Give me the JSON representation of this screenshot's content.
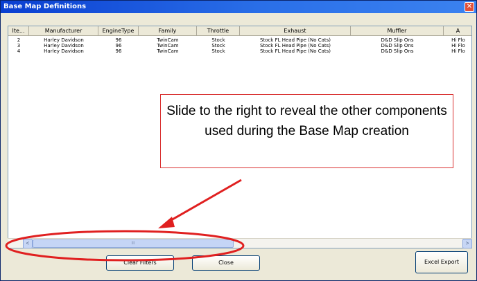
{
  "window": {
    "title": "Base Map Definitions",
    "close_glyph": "✕"
  },
  "grid": {
    "columns": [
      "Ite...",
      "Manufacturer",
      "EngineType",
      "Family",
      "Throttle",
      "Exhaust",
      "Muffler",
      "A"
    ],
    "rows": [
      [
        "2",
        "Harley Davidson",
        "96",
        "TwinCam",
        "Stock",
        "Stock FL Head Pipe (No Cats)",
        "D&D Slip Ons",
        "Hi Flo"
      ],
      [
        "3",
        "Harley Davidson",
        "96",
        "TwinCam",
        "Stock",
        "Stock FL Head Pipe (No Cats)",
        "D&D Slip Ons",
        "Hi Flo"
      ],
      [
        "4",
        "Harley Davidson",
        "96",
        "TwinCam",
        "Stock",
        "Stock FL Head Pipe (No Cats)",
        "D&D Slip Ons",
        "Hi Flo"
      ]
    ]
  },
  "scrollbar": {
    "left_arrow": "<",
    "right_arrow": ">",
    "thumb_grip": "III"
  },
  "buttons": {
    "clear_filters": "Clear Filters",
    "close": "Close",
    "excel_export": "Excel Export"
  },
  "callout": {
    "text": "Slide to the right to reveal the other components used during the Base Map creation"
  },
  "colors": {
    "annotation": "#e02020",
    "titlebar": "#0a3fd1"
  },
  "icons": [
    "close-icon",
    "scroll-left-arrow-icon",
    "scroll-right-arrow-icon"
  ]
}
